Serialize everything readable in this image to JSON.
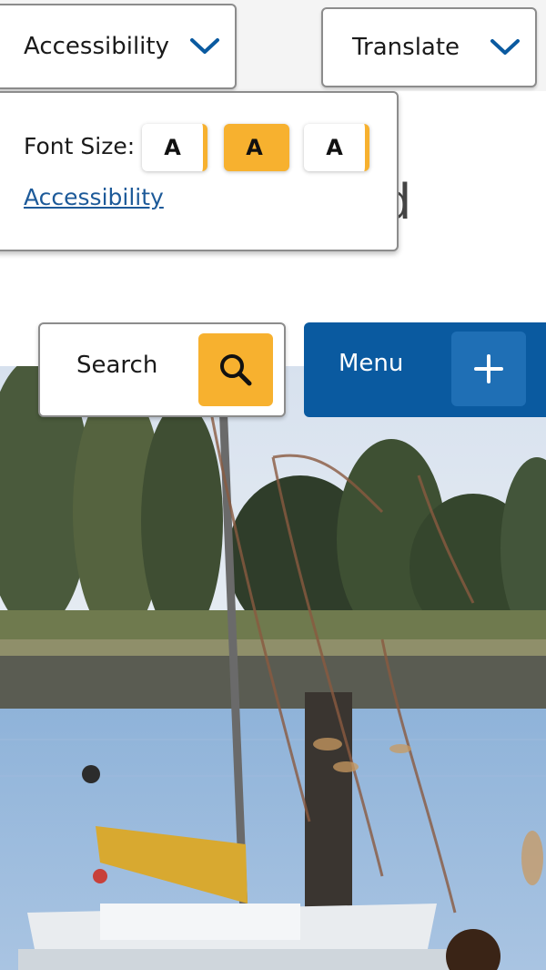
{
  "header": {
    "accessibility_label": "Accessibility",
    "translate_label": "Translate",
    "partial_background_text": "d"
  },
  "accessibility_menu": {
    "font_size_label": "Font Size:",
    "font_sizes": [
      "A",
      "A",
      "A"
    ],
    "selected_font_size_index": 1,
    "accessibility_link": "Accessibility"
  },
  "nav": {
    "search_label": "Search",
    "menu_label": "Menu"
  },
  "colors": {
    "accent_yellow": "#f7b12f",
    "primary_blue": "#0a5aa0",
    "link_blue": "#1d5a99"
  },
  "icons": {
    "search": "search-icon",
    "menu_toggle": "plus-icon",
    "dropdown": "chevron-down-icon"
  }
}
